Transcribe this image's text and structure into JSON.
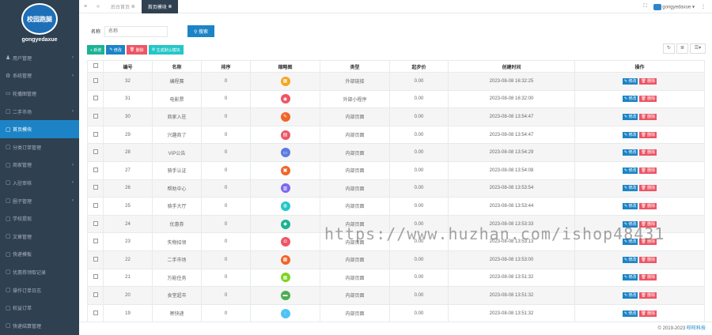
{
  "sidebar": {
    "logo_text": "校园跑腿",
    "username": "gongyedaxue",
    "items": [
      {
        "label": "用户管理",
        "arrow": true
      },
      {
        "label": "系统管理",
        "arrow": true
      },
      {
        "label": "轮播图管理",
        "arrow": false
      },
      {
        "label": "二手市场",
        "arrow": true
      },
      {
        "label": "首页模块",
        "arrow": false
      },
      {
        "label": "分类订单管理",
        "arrow": false
      },
      {
        "label": "商家管理",
        "arrow": true
      },
      {
        "label": "入驻审核",
        "arrow": true
      },
      {
        "label": "圈子管理",
        "arrow": true
      },
      {
        "label": "学校提现",
        "arrow": false
      },
      {
        "label": "文章管理",
        "arrow": false
      },
      {
        "label": "快递模板",
        "arrow": false
      },
      {
        "label": "优惠券领取记录",
        "arrow": false
      },
      {
        "label": "操作订单日志",
        "arrow": false
      },
      {
        "label": "权益订单",
        "arrow": false
      },
      {
        "label": "快递结算管理",
        "arrow": false
      }
    ],
    "active_index": 4
  },
  "topbar": {
    "tabs": [
      {
        "label": "后台首页"
      },
      {
        "label": "首页模块"
      }
    ],
    "username": "gongyedaxue"
  },
  "search": {
    "label": "名称",
    "placeholder": "名称",
    "button": "搜索"
  },
  "toolbar": {
    "add": "+ 新增",
    "edit": "修改",
    "delete": "删除",
    "config": "生成默认模块"
  },
  "table": {
    "headers": [
      "",
      "编号",
      "名称",
      "排序",
      "缩略图",
      "类型",
      "起步价",
      "创建时间",
      "操作"
    ],
    "edit_label": "修改",
    "delete_label": "删除",
    "rows": [
      {
        "id": "32",
        "name": "编程赛",
        "sort": "0",
        "icon_color": "#f5a623",
        "icon": "▦",
        "type": "外部链接",
        "price": "0.00",
        "time": "2023-08-08 16:32:25"
      },
      {
        "id": "31",
        "name": "电影票",
        "sort": "0",
        "icon_color": "#ed5565",
        "icon": "◉",
        "type": "外部小程序",
        "price": "0.00",
        "time": "2023-08-08 16:32:00"
      },
      {
        "id": "30",
        "name": "商家入驻",
        "sort": "0",
        "icon_color": "#f0642a",
        "icon": "✎",
        "type": "内部页面",
        "price": "0.00",
        "time": "2023-08-08 13:54:47"
      },
      {
        "id": "29",
        "name": "兴趣商了",
        "sort": "0",
        "icon_color": "#ed5565",
        "icon": "▤",
        "type": "内部页面",
        "price": "0.00",
        "time": "2023-08-08 13:54:47"
      },
      {
        "id": "28",
        "name": "VIP公告",
        "sort": "0",
        "icon_color": "#5b7be0",
        "icon": "▭",
        "type": "内部页面",
        "price": "0.00",
        "time": "2023-08-08 13:54:29"
      },
      {
        "id": "27",
        "name": "骑手认证",
        "sort": "0",
        "icon_color": "#f0642a",
        "icon": "▣",
        "type": "内部页面",
        "price": "0.00",
        "time": "2023-08-08 13:54:08"
      },
      {
        "id": "26",
        "name": "帮助中心",
        "sort": "0",
        "icon_color": "#7b68ee",
        "icon": "▥",
        "type": "内部页面",
        "price": "0.00",
        "time": "2023-08-08 13:53:54"
      },
      {
        "id": "25",
        "name": "骑手大厅",
        "sort": "0",
        "icon_color": "#23c6c8",
        "icon": "◍",
        "type": "内部页面",
        "price": "0.00",
        "time": "2023-08-08 13:53:44"
      },
      {
        "id": "24",
        "name": "优惠券",
        "sort": "0",
        "icon_color": "#1ab394",
        "icon": "◆",
        "type": "内部页面",
        "price": "0.00",
        "time": "2023-08-08 13:53:33"
      },
      {
        "id": "23",
        "name": "失物招领",
        "sort": "0",
        "icon_color": "#ed5565",
        "icon": "◘",
        "type": "内部页面",
        "price": "0.00",
        "time": "2023-08-08 13:53:13"
      },
      {
        "id": "22",
        "name": "二手市场",
        "sort": "0",
        "icon_color": "#f0642a",
        "icon": "▩",
        "type": "内部页面",
        "price": "0.00",
        "time": "2023-08-08 13:53:00"
      },
      {
        "id": "21",
        "name": "万能任务",
        "sort": "0",
        "icon_color": "#7ed321",
        "icon": "▦",
        "type": "内部页面",
        "price": "0.00",
        "time": "2023-08-08 13:51:32"
      },
      {
        "id": "20",
        "name": "食堂超市",
        "sort": "0",
        "icon_color": "#4caf50",
        "icon": "▬",
        "type": "内部页面",
        "price": "0.00",
        "time": "2023-08-08 13:51:32"
      },
      {
        "id": "19",
        "name": "寄快递",
        "sort": "0",
        "icon_color": "#4fc3f7",
        "icon": "◌",
        "type": "内部页面",
        "price": "0.00",
        "time": "2023-08-08 13:51:32"
      }
    ]
  },
  "footer": {
    "copyright": "© 2019-2023",
    "company": "旺旺科技"
  },
  "watermark": "https://www.huzhan.com/ishop48431"
}
